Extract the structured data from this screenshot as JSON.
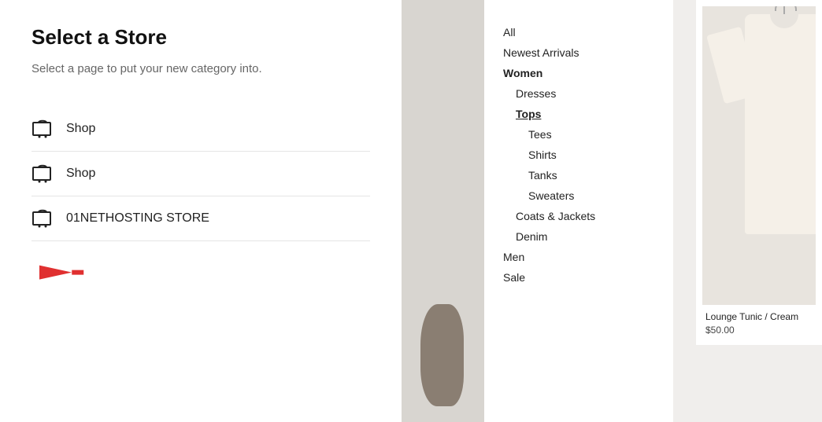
{
  "leftPanel": {
    "title": "Select a Store",
    "subtitle": "Select a page to put your new category into.",
    "stores": [
      {
        "label": "Shop",
        "id": "shop-1"
      },
      {
        "label": "Shop",
        "id": "shop-2"
      },
      {
        "label": "01NETHOSTING STORE",
        "id": "store-01net"
      }
    ]
  },
  "navigation": {
    "items": [
      {
        "label": "All",
        "level": 0,
        "style": "normal"
      },
      {
        "label": "Newest Arrivals",
        "level": 0,
        "style": "normal"
      },
      {
        "label": "Women",
        "level": 0,
        "style": "bold"
      },
      {
        "label": "Dresses",
        "level": 1,
        "style": "normal"
      },
      {
        "label": "Tops",
        "level": 1,
        "style": "underline"
      },
      {
        "label": "Tees",
        "level": 2,
        "style": "normal"
      },
      {
        "label": "Shirts",
        "level": 2,
        "style": "normal"
      },
      {
        "label": "Tanks",
        "level": 2,
        "style": "normal"
      },
      {
        "label": "Sweaters",
        "level": 2,
        "style": "normal"
      },
      {
        "label": "Coats & Jackets",
        "level": 1,
        "style": "normal"
      },
      {
        "label": "Denim",
        "level": 1,
        "style": "normal"
      },
      {
        "label": "Men",
        "level": 0,
        "style": "normal"
      },
      {
        "label": "Sale",
        "level": 0,
        "style": "normal"
      }
    ]
  },
  "product": {
    "name": "Lounge Tunic / Cream",
    "price": "$50.00"
  }
}
